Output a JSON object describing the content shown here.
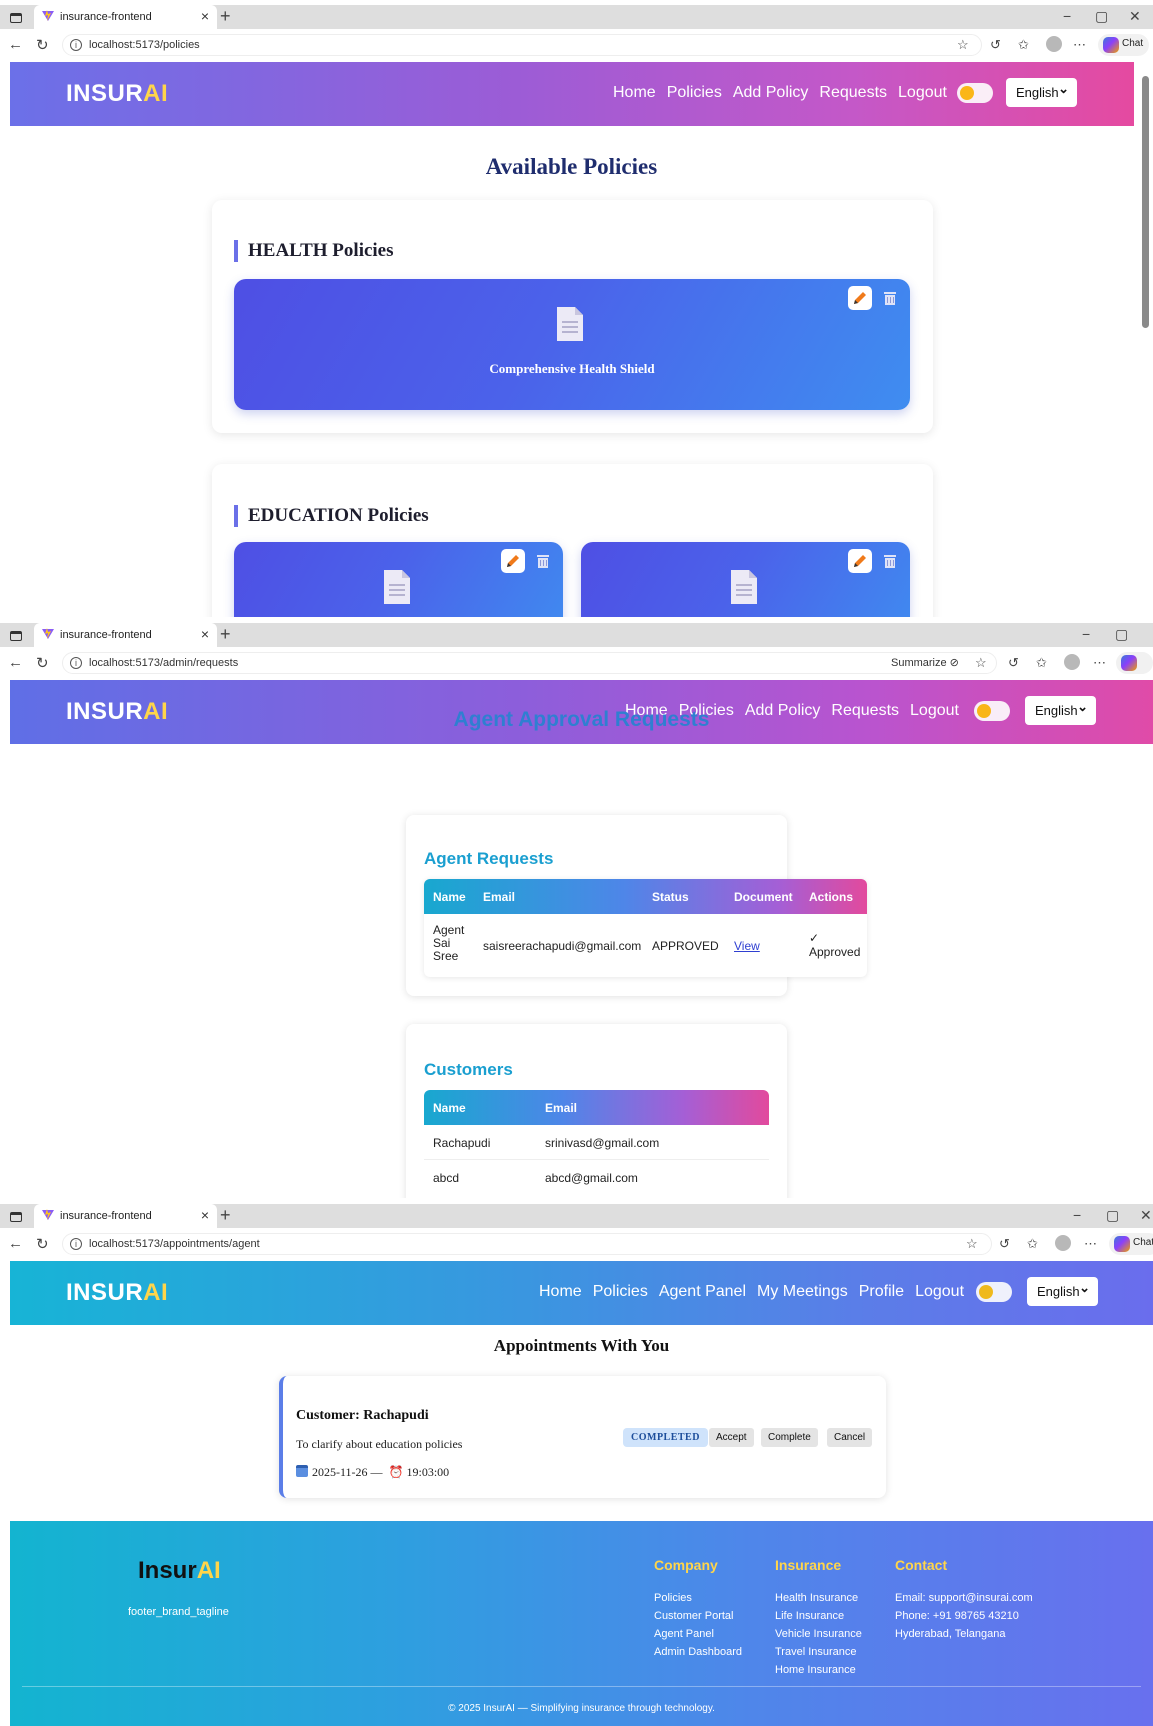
{
  "colors": {
    "admin_nav_gradient": [
      "#6b70e8",
      "#9c5cd6",
      "#e54aa0"
    ],
    "agent_nav_gradient": [
      "#17b4d6",
      "#3a96e0",
      "#6a6ded"
    ],
    "brand_accent": "#ffd54a",
    "heading_blue": "#2f7fd1",
    "policy_card_gradient": [
      "#4e4fe4",
      "#3f8df0"
    ]
  },
  "screens": {
    "policies": {
      "tab": {
        "title": "insurance-frontend",
        "favicon": "vite-icon"
      },
      "url": "localhost:5173/policies",
      "brand": {
        "main": "INSUR",
        "accent": "AI"
      },
      "nav": [
        "Home",
        "Policies",
        "Add Policy",
        "Requests",
        "Logout"
      ],
      "language": "English",
      "theme_toggle_icon": "toggle-icon",
      "copilot_label": "Chat",
      "page_title": "Available Policies",
      "sections": [
        {
          "heading": "HEALTH Policies",
          "policies": [
            {
              "title": "Comprehensive Health Shield",
              "icon": "document-icon"
            }
          ]
        },
        {
          "heading": "EDUCATION Policies",
          "policies": [
            {
              "title": "",
              "icon": "document-icon"
            },
            {
              "title": "",
              "icon": "document-icon"
            }
          ]
        }
      ]
    },
    "requests": {
      "tab": {
        "title": "insurance-frontend",
        "favicon": "vite-icon"
      },
      "url": "localhost:5173/admin/requests",
      "summarize_label": "Summarize",
      "brand": {
        "main": "INSUR",
        "accent": "AI"
      },
      "nav": [
        "Home",
        "Policies",
        "Add Policy",
        "Requests",
        "Logout"
      ],
      "language": "English",
      "page_title": "Agent Approval Requests",
      "agent_requests": {
        "heading": "Agent Requests",
        "columns": [
          "Name",
          "Email",
          "Status",
          "Document",
          "Actions"
        ],
        "rows": [
          {
            "name": [
              "Agent",
              "Sai",
              "Sree"
            ],
            "email": "saisreerachapudi@gmail.com",
            "status": "APPROVED",
            "document": "View",
            "action_mark": "✓",
            "action_text": "Approved"
          }
        ]
      },
      "customers": {
        "heading": "Customers",
        "columns": [
          "Name",
          "Email"
        ],
        "rows": [
          {
            "name": "Rachapudi",
            "email": "srinivasd@gmail.com"
          },
          {
            "name": "abcd",
            "email": "abcd@gmail.com"
          }
        ]
      }
    },
    "appointments": {
      "tab": {
        "title": "insurance-frontend",
        "favicon": "vite-icon"
      },
      "url": "localhost:5173/appointments/agent",
      "brand": {
        "main": "INSUR",
        "accent": "AI"
      },
      "nav": [
        "Home",
        "Policies",
        "Agent Panel",
        "My Meetings",
        "Profile",
        "Logout"
      ],
      "language": "English",
      "copilot_label": "Chat",
      "page_title": "Appointments With You",
      "appointment": {
        "customer": "Customer: Rachapudi",
        "purpose": "To clarify about education policies",
        "date": "2025-11-26",
        "separator": "—",
        "time": "19:03:00",
        "status": "COMPLETED",
        "actions": [
          "Accept",
          "Complete",
          "Cancel"
        ]
      },
      "footer": {
        "brand": {
          "main": "Insur",
          "accent": "AI"
        },
        "tagline": "footer_brand_tagline",
        "columns": [
          {
            "heading": "Company",
            "items": [
              "Policies",
              "Customer Portal",
              "Agent Panel",
              "Admin Dashboard"
            ]
          },
          {
            "heading": "Insurance",
            "items": [
              "Health Insurance",
              "Life Insurance",
              "Vehicle Insurance",
              "Travel Insurance",
              "Home Insurance"
            ]
          },
          {
            "heading": "Contact",
            "items": [
              "Email: support@insurai.com",
              "Phone: +91 98765 43210",
              "Hyderabad, Telangana"
            ]
          }
        ],
        "copyright": "© 2025 InsurAI — Simplifying insurance through technology."
      }
    }
  }
}
